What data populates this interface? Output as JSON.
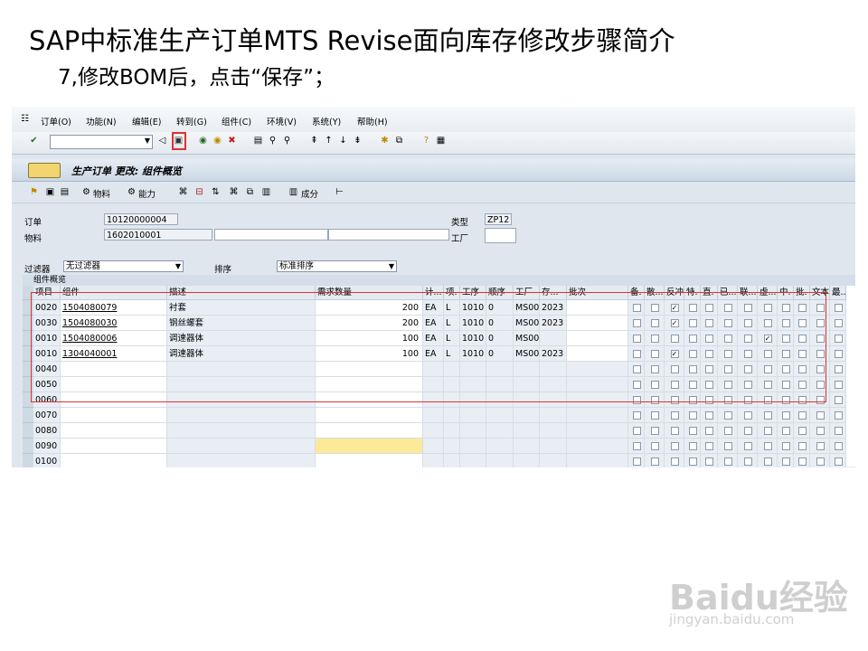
{
  "slide": {
    "title": "SAP中标准生产订单MTS Revise面向库存修改步骤简介",
    "subtitle": "7,修改BOM后，点击“保存”；"
  },
  "menu": [
    "订单(O)",
    "功能(N)",
    "编辑(E)",
    "转到(G)",
    "组件(C)",
    "环境(V)",
    "系统(Y)",
    "帮助(H)"
  ],
  "screen_title": "生产订单 更改: 组件概览",
  "app_toolbar": {
    "material": "物料",
    "capacity": "能力",
    "component": "成分"
  },
  "header": {
    "order_label": "订单",
    "order_value": "10120000004",
    "type_label": "类型",
    "type_value": "ZP12",
    "material_label": "物料",
    "material_value": "1602010001",
    "plant_label": "工厂",
    "filter_label": "过滤器",
    "filter_value": "无过滤器",
    "sort_label": "排序",
    "sort_value": "标准排序"
  },
  "grid": {
    "title": "组件概览",
    "columns": [
      "项目",
      "组件",
      "描述",
      "需求数量",
      "计...",
      "项.",
      "工序",
      "顺序",
      "工厂",
      "存...",
      "批次",
      "备.",
      "散...",
      "反冲",
      "特.",
      "直.",
      "已...",
      "联...",
      "虚...",
      "中.",
      "批.",
      "文本",
      "最..."
    ],
    "rows": [
      {
        "item": "0020",
        "component": "1504080079",
        "desc": "衬套",
        "qty": "200",
        "unit": "EA",
        "cat": "L",
        "op": "1010",
        "seq": "0",
        "plant": "MS00",
        "stor": "2023",
        "backflush": true,
        "phantom": false
      },
      {
        "item": "0030",
        "component": "1504080030",
        "desc": "钢丝螺套",
        "qty": "200",
        "unit": "EA",
        "cat": "L",
        "op": "1010",
        "seq": "0",
        "plant": "MS00",
        "stor": "2023",
        "backflush": true,
        "phantom": false
      },
      {
        "item": "0010",
        "component": "1504080006",
        "desc": "调速器体",
        "qty": "100",
        "unit": "EA",
        "cat": "L",
        "op": "1010",
        "seq": "0",
        "plant": "MS00",
        "stor": "",
        "backflush": false,
        "phantom": true
      },
      {
        "item": "0010",
        "component": "1304040001",
        "desc": "调速器体",
        "qty": "100",
        "unit": "EA",
        "cat": "L",
        "op": "1010",
        "seq": "0",
        "plant": "MS00",
        "stor": "2023",
        "backflush": true,
        "phantom": false
      }
    ],
    "empty_items": [
      "0040",
      "0050",
      "0060",
      "0070",
      "0080",
      "0090",
      "0100"
    ]
  },
  "watermark": {
    "logo": "Baidu经验",
    "url": "jingyan.baidu.com"
  },
  "colors": {
    "highlight": "#e03030",
    "sap_bg": "#dfe6ee",
    "input_focus": "#fde99a"
  }
}
